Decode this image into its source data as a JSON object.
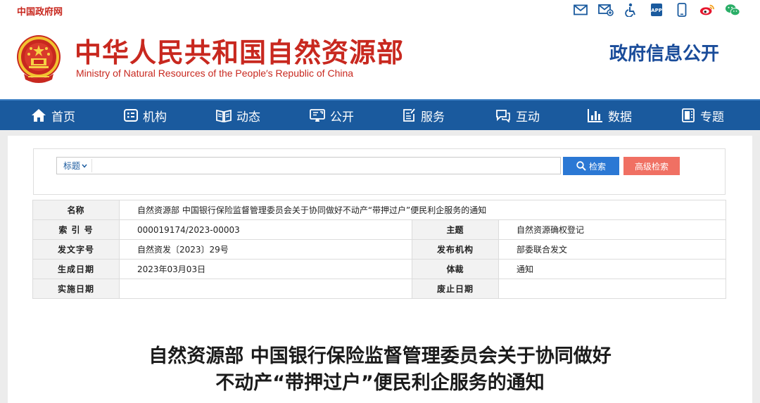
{
  "topbar": {
    "gov_link": "中国政府网",
    "icons": [
      "mail-icon",
      "subscribe-mail-icon",
      "accessibility-icon",
      "app-icon",
      "mobile-icon",
      "weibo-icon",
      "wechat-icon"
    ],
    "app_icon_text": "APP"
  },
  "header": {
    "title_cn": "中华人民共和国自然资源部",
    "title_en": "Ministry of Natural Resources of the People′s Republic of China",
    "section": "政府信息公开"
  },
  "nav": {
    "items": [
      {
        "label": "首页",
        "icon": "home-icon"
      },
      {
        "label": "机构",
        "icon": "organization-icon"
      },
      {
        "label": "动态",
        "icon": "news-icon"
      },
      {
        "label": "公开",
        "icon": "disclosure-icon"
      },
      {
        "label": "服务",
        "icon": "service-icon"
      },
      {
        "label": "互动",
        "icon": "interaction-icon"
      },
      {
        "label": "数据",
        "icon": "data-icon"
      },
      {
        "label": "专题",
        "icon": "topic-icon"
      }
    ]
  },
  "search": {
    "scope": "标题",
    "value": "",
    "search_label": "检索",
    "advanced_label": "高级检索"
  },
  "meta": {
    "name_label_a": "名",
    "name_label_b": "称",
    "name_value": "自然资源部 中国银行保险监督管理委员会关于协同做好不动产“带押过户”便民利企服务的通知",
    "index_label": "索 引 号",
    "index_value": "000019174/2023-00003",
    "subject_label_a": "主",
    "subject_label_b": "题",
    "subject_value": "自然资源确权登记",
    "docno_label": "发文字号",
    "docno_value": "自然资发〔2023〕29号",
    "issuer_label": "发布机构",
    "issuer_value": "部委联合发文",
    "created_label": "生成日期",
    "created_value": "2023年03月03日",
    "genre_label_a": "体",
    "genre_label_b": "裁",
    "genre_value": "通知",
    "effective_label": "实施日期",
    "effective_value": "",
    "abolish_label": "废止日期",
    "abolish_value": ""
  },
  "article": {
    "title_line1": "自然资源部 中国银行保险监督管理委员会关于协同做好",
    "title_line2": "不动产“带押过户”便民利企服务的通知"
  },
  "colors": {
    "brand_red": "#c8281f",
    "nav_blue": "#1a5a9e",
    "search_blue": "#2b78d4",
    "advanced_coral": "#f07063",
    "section_blue": "#1a4c9a"
  }
}
